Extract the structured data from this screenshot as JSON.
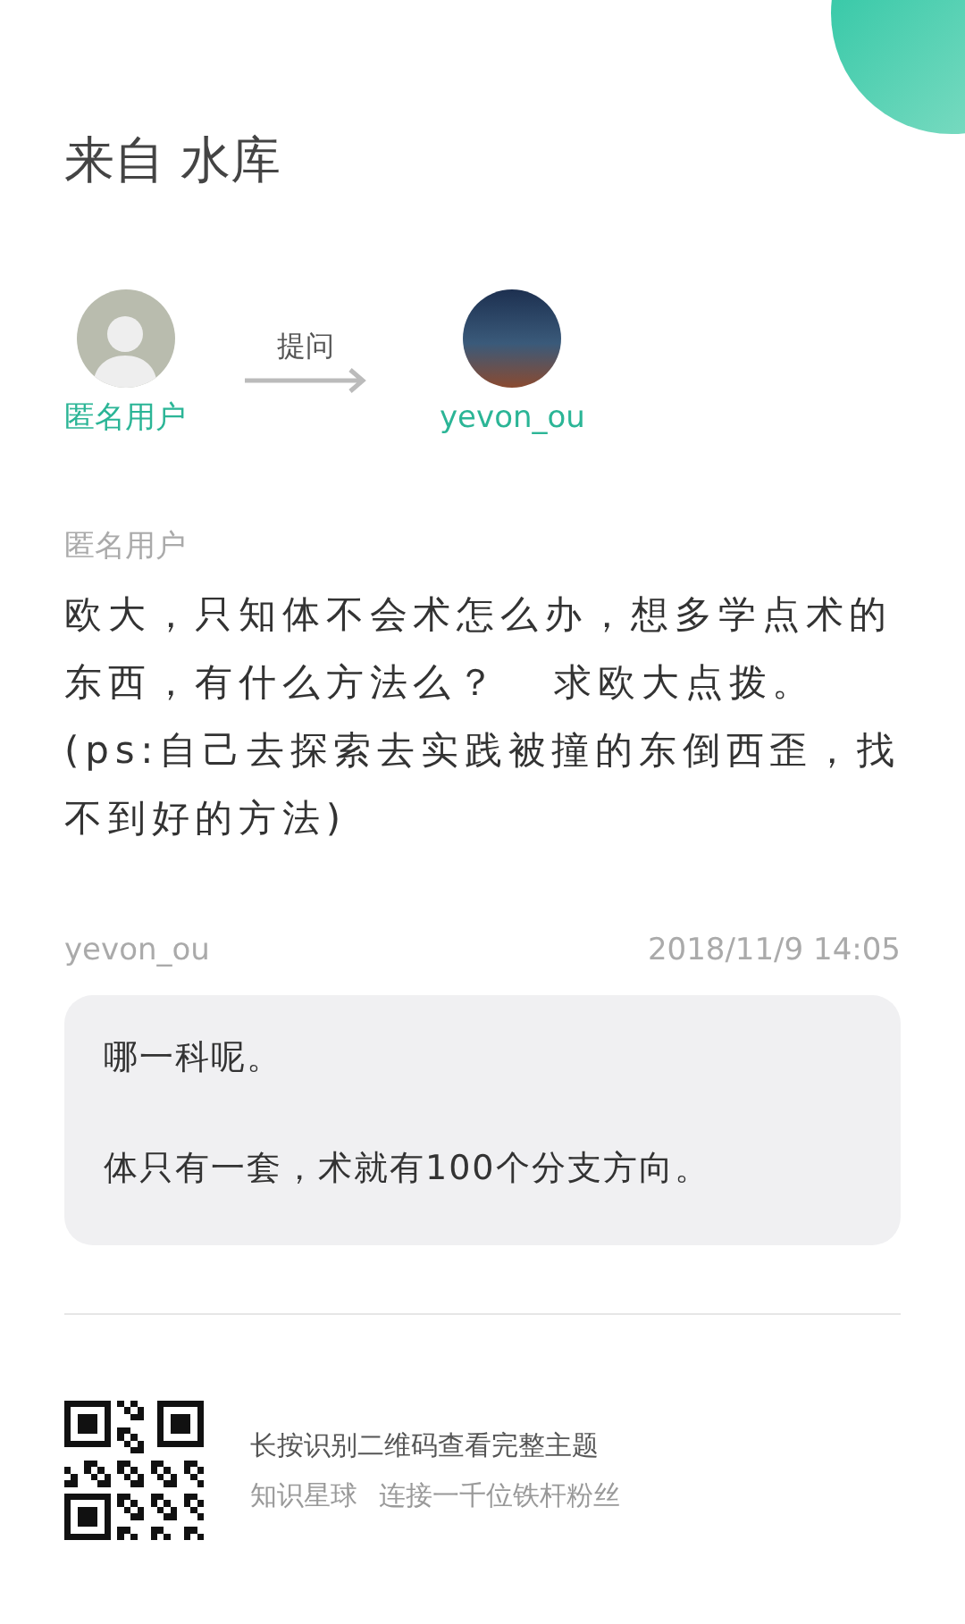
{
  "title": "来自 水库",
  "flow": {
    "asker": {
      "name": "匿名用户"
    },
    "action": "提问",
    "answerer": {
      "name": "yevon_ou"
    }
  },
  "question": {
    "author": "匿名用户",
    "text": "欧大，只知体不会术怎么办，想多学点术的东西，有什么方法么？   求欧大点拨。(ps:自己去探索去实践被撞的东倒西歪，找不到好的方法)"
  },
  "answer": {
    "author": "yevon_ou",
    "time": "2018/11/9 14:05",
    "paragraphs": [
      "哪一科呢。",
      "体只有一套，术就有100个分支方向。"
    ]
  },
  "footer": {
    "prompt": "长按识别二维码查看完整主题",
    "brand": "知识星球",
    "slogan": "连接一千位铁杆粉丝"
  }
}
